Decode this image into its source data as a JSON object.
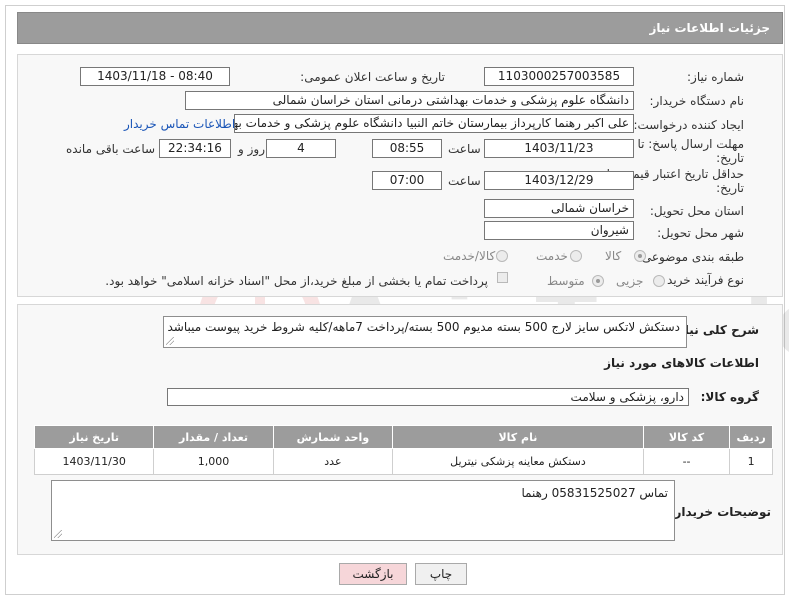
{
  "header": {
    "title": "جزئیات اطلاعات نیاز"
  },
  "form": {
    "need_number": {
      "label": "شماره نیاز:",
      "value": "1103000257003585"
    },
    "announce_datetime": {
      "label": "تاریخ و ساعت اعلان عمومی:",
      "value": "1403/11/18 - 08:40"
    },
    "buyer_org": {
      "label": "نام دستگاه خریدار:",
      "value": "دانشگاه علوم پزشکی و خدمات بهداشتی درمانی استان خراسان شمالی"
    },
    "requester": {
      "label": "ایجاد کننده درخواست:",
      "value": "علی اکبر رهنما کارپرداز بیمارستان خاتم النبیا دانشگاه علوم پزشکی و خدمات بهداشتی درمانی",
      "contact_link": "اطلاعات تماس خریدار"
    },
    "reply_deadline": {
      "label_line1": "مهلت ارسال پاسخ: تا",
      "label_line2": "تاریخ:",
      "date": "1403/11/23",
      "time_label": "ساعت",
      "time": "08:55",
      "days": "4",
      "days_label": "روز و",
      "remaining": "22:34:16",
      "remaining_label": "ساعت باقی مانده"
    },
    "price_validity": {
      "label_line1": "حداقل تاریخ اعتبار قیمت: تا",
      "label_line2": "تاریخ:",
      "date": "1403/12/29",
      "time_label": "ساعت",
      "time": "07:00"
    },
    "delivery_province": {
      "label": "استان محل تحویل:",
      "value": "خراسان شمالی"
    },
    "delivery_city": {
      "label": "شهر محل تحویل:",
      "value": "شیروان"
    },
    "category": {
      "label": "طبقه بندی موضوعی:",
      "options": [
        "کالا",
        "خدمت",
        "کالا/خدمت"
      ],
      "selected": "کالا"
    },
    "process_type": {
      "label": "نوع فرآیند خرید :",
      "options": [
        "جزیی",
        "متوسط"
      ],
      "selected": "جزیی",
      "payment_note": "پرداخت تمام یا بخشی از مبلغ خرید،از محل \"اسناد خزانه اسلامی\" خواهد بود."
    }
  },
  "description": {
    "label": "شرح کلی نیاز:",
    "value": "دستکش لاتکس سایز لارج 500 بسته مدیوم 500 بسته/پرداخت 7ماهه/کلیه شروط خرید پیوست میباشد"
  },
  "goods_info_title": "اطلاعات کالاهای مورد نیاز",
  "goods_group": {
    "label": "گروه کالا:",
    "value": "دارو، پزشکی و سلامت"
  },
  "table": {
    "headers": [
      "ردیف",
      "کد کالا",
      "نام کالا",
      "واحد شمارش",
      "تعداد / مقدار",
      "تاریخ نیاز"
    ],
    "rows": [
      [
        "1",
        "--",
        "دستکش معاینه پزشکی نیتریل",
        "عدد",
        "1,000",
        "1403/11/30"
      ]
    ]
  },
  "buyer_notes": {
    "label": "توضیحات خریدار:",
    "value": "تماس 05831525027 رهنما"
  },
  "buttons": {
    "print": "چاپ",
    "back": "بازگشت"
  },
  "colors": {
    "header_bg": "#9c9c9c",
    "panel_bg": "#f8f8f8",
    "link": "#1a55b7",
    "back_button_bg": "#f6d6d9"
  }
}
